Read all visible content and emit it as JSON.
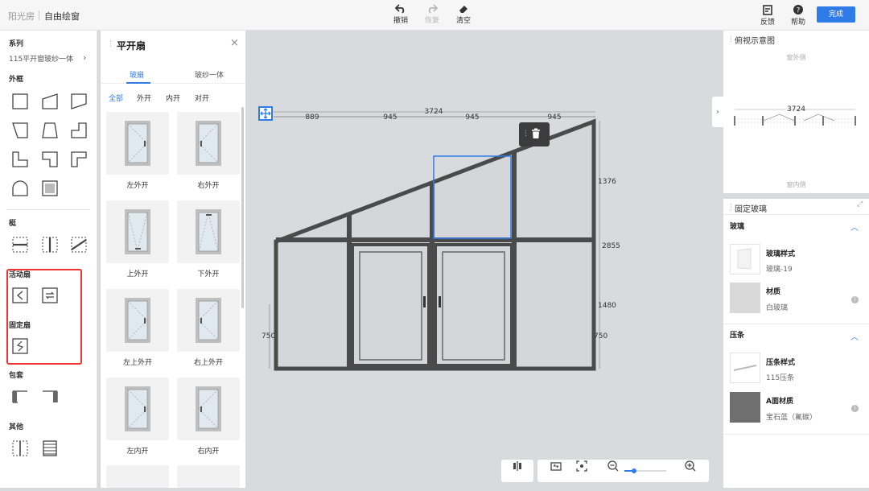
{
  "header": {
    "breadcrumb_root": "阳光房",
    "breadcrumb_current": "自由绘窗",
    "undo_label": "撤销",
    "redo_label": "恢复",
    "clear_label": "清空",
    "feedback_label": "反馈",
    "help_label": "帮助",
    "done_label": "完成"
  },
  "sidebar": {
    "series_title": "系列",
    "series_value": "115平开窗玻纱一体",
    "frame_title": "外框",
    "mullion_title": "梃",
    "active_sash_title": "活动扇",
    "fixed_sash_title": "固定扇",
    "casing_title": "包套",
    "other_title": "其他"
  },
  "panel": {
    "title": "平开扇",
    "tabs": [
      "玻扇",
      "玻纱一体"
    ],
    "filters": [
      "全部",
      "外开",
      "内开",
      "对开"
    ],
    "items": [
      "左外开",
      "右外开",
      "上外开",
      "下外开",
      "左上外开",
      "右上外开",
      "左内开",
      "右内开"
    ]
  },
  "canvas": {
    "dims_top": [
      "889",
      "945",
      "945",
      "945"
    ],
    "total_width": "3724",
    "right_dims": [
      "1376",
      "2855",
      "1480",
      "750"
    ],
    "left_dim": "750"
  },
  "overview": {
    "title": "俯视示意图",
    "outside_label": "窗外侧",
    "inside_label": "窗内侧",
    "width_label": "3724"
  },
  "props": {
    "title": "固定玻璃",
    "glass_section": "玻璃",
    "glass_style_label": "玻璃样式",
    "glass_style_value": "玻璃-19",
    "material_label": "材质",
    "material_value": "白玻璃",
    "bead_section": "压条",
    "bead_style_label": "压条样式",
    "bead_style_value": "115压条",
    "a_material_label": "A面材质",
    "a_material_value": "宝石蓝（氟碳）"
  },
  "colors": {
    "accent": "#2f7be8",
    "frame": "#4a4a4a",
    "highlight_border": "#e33333"
  }
}
